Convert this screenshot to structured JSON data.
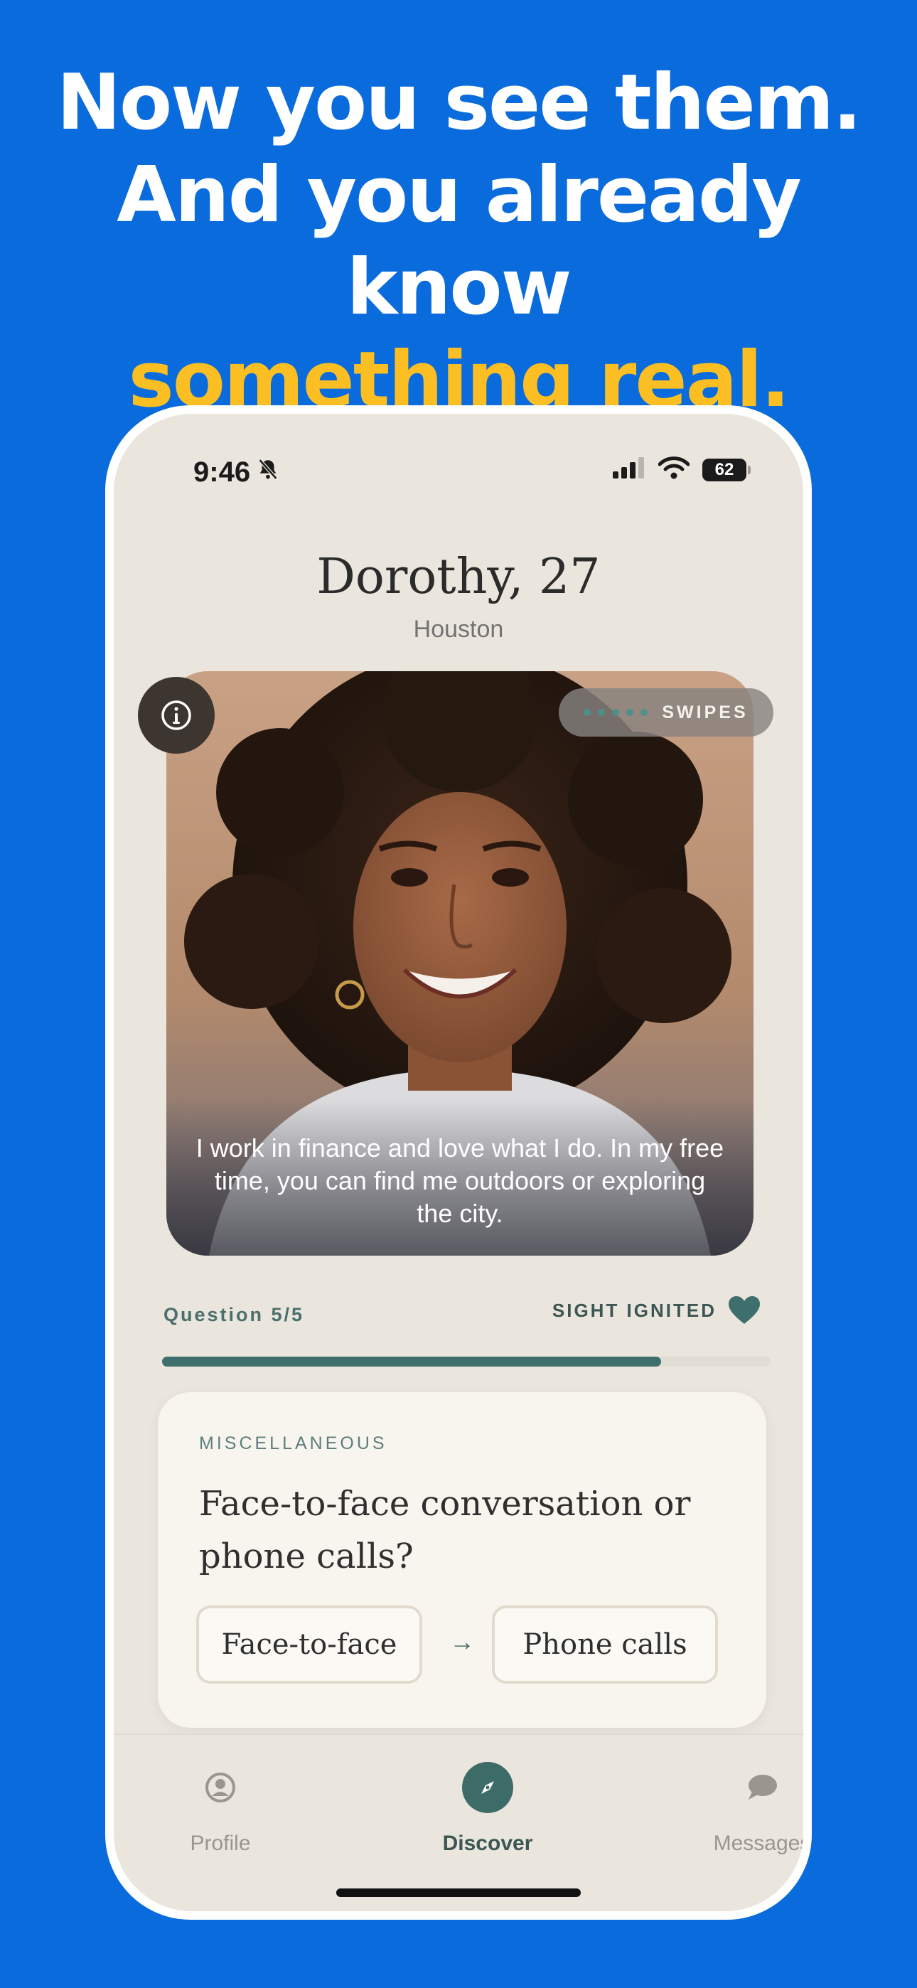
{
  "headline": {
    "line1": "Now you see them.",
    "line2": "And you already know",
    "line3": "something real."
  },
  "status_bar": {
    "time": "9:46",
    "battery": "62"
  },
  "profile": {
    "name_age": "Dorothy, 27",
    "city": "Houston",
    "bio": "I work in finance and love what I do. In my free time, you can find me outdoors or exploring the city.",
    "swipes_label": "SWIPES",
    "swipe_dots": 5
  },
  "question_progress": {
    "label": "Question 5/5",
    "progress": 0.82,
    "status_label": "SIGHT IGNITED"
  },
  "question_card": {
    "category": "MISCELLANEOUS",
    "question": "Face-to-face conversation or phone calls?",
    "option_a": "Face-to-face",
    "option_b": "Phone calls",
    "arrow": "→"
  },
  "tabs": {
    "profile": "Profile",
    "discover": "Discover",
    "messages": "Messages"
  },
  "colors": {
    "background": "#0a6bdc",
    "highlight": "#fbbf24",
    "accent_teal": "#3f6f6c",
    "screen_bg": "#ebe6dd"
  }
}
